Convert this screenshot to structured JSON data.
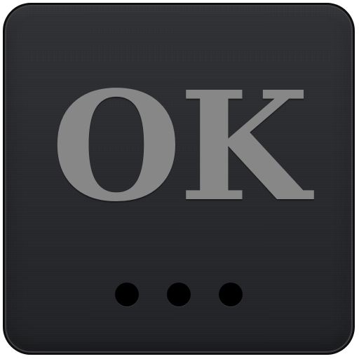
{
  "icon": {
    "label": "OK",
    "label_color": "#878787",
    "background_color": "#2a2b2f",
    "indicator": {
      "type": "three-dots",
      "count": 3,
      "color": "#000000"
    }
  }
}
